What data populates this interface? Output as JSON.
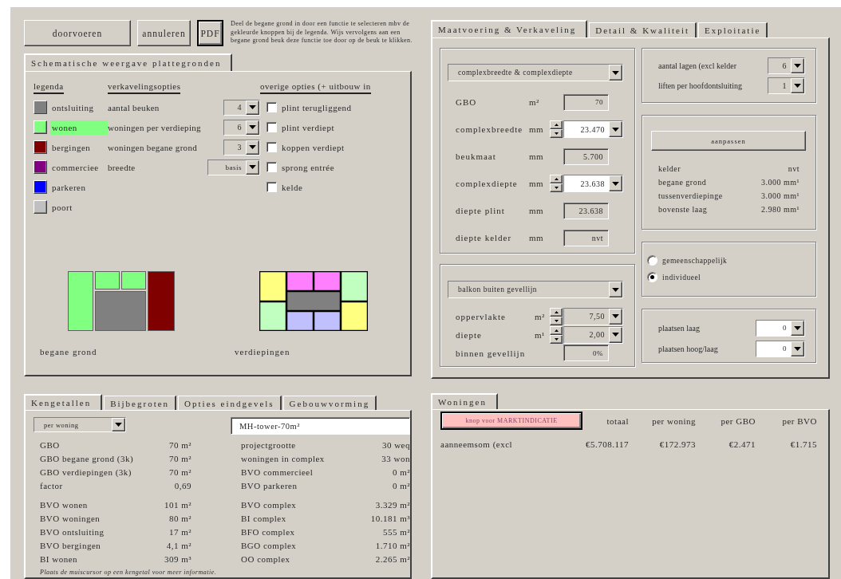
{
  "actions": {
    "buttons": [
      {
        "label": "doorvoeren",
        "focused": false
      },
      {
        "label": "annuleren",
        "focused": false
      },
      {
        "label": "PDF",
        "focused": true
      }
    ],
    "help": "Deel de begane grond in door een functie te selecteren mbv de gekleurde knoppen bij de legenda. Wijs vervolgens aan een begane grond beuk deze functie toe door op de beuk te klikken."
  },
  "schematic": {
    "tabs": [
      {
        "label": "Schematische weergave plattegronden",
        "selected": true
      }
    ],
    "legend_heading": "legenda",
    "legend": [
      {
        "label": "ontsluiting",
        "color": "#808080",
        "selected": false
      },
      {
        "label": "wonen",
        "color": "#80ff80",
        "selected": true
      },
      {
        "label": "bergingen",
        "color": "#800000",
        "selected": false
      },
      {
        "label": "commerciee",
        "color": "#800080",
        "selected": false
      },
      {
        "label": "parkeren",
        "color": "#0000ff",
        "selected": false
      },
      {
        "label": "poort",
        "color": "#c0c0c0",
        "selected": false
      }
    ],
    "lot_heading": "verkavelingsopties",
    "lot_options": [
      {
        "label": "aantal beuken",
        "value": "4"
      },
      {
        "label": "woningen per verdieping",
        "value": "6"
      },
      {
        "label": "woningen begane grond",
        "value": "3"
      },
      {
        "label": "breedte",
        "value": "basis"
      }
    ],
    "other_heading": "overige opties (+ uitbouw in",
    "other_options": [
      {
        "label": "plint terugliggend",
        "checked": false
      },
      {
        "label": "plint verdiept",
        "checked": false
      },
      {
        "label": "koppen verdiept",
        "checked": false
      },
      {
        "label": "sprong entrée",
        "checked": false
      },
      {
        "label": "kelde",
        "checked": false
      }
    ],
    "plans": [
      {
        "label": "begane grond",
        "kind": "ground",
        "cells": [
          {
            "color": "#80ff80"
          },
          {
            "color": "#80ff80"
          },
          {
            "color": "#80ff80"
          },
          {
            "color": "#808080"
          },
          {
            "color": "#800000"
          }
        ]
      },
      {
        "label": "verdiepingen",
        "kind": "floor",
        "cells": [
          {
            "color": "#ffff80"
          },
          {
            "color": "#c0ffc0"
          },
          {
            "color": "#ff80ff"
          },
          {
            "color": "#ff80ff"
          },
          {
            "color": "#808080"
          },
          {
            "color": "#c0c0ff"
          },
          {
            "color": "#c0c0ff"
          },
          {
            "color": "#c0ffc0"
          },
          {
            "color": "#ffff80"
          }
        ]
      }
    ]
  },
  "layout": {
    "tabs": [
      {
        "label": "Maatvoering & Verkaveling",
        "selected": true
      },
      {
        "label": "Detail & Kwaliteit",
        "selected": false
      },
      {
        "label": "Exploitatie",
        "selected": false
      }
    ],
    "dimensions": {
      "mode": "complexbreedte & complexdiepte",
      "rows": [
        {
          "label": "GBO",
          "unit": "m²",
          "value": "70",
          "kind": "readonly",
          "disabled": true
        },
        {
          "label": "complexbreedte",
          "unit": "mm",
          "value": "23.470",
          "kind": "spinner",
          "disabled": false
        },
        {
          "label": "beukmaat",
          "unit": "mm",
          "value": "5.700",
          "kind": "readonly",
          "disabled": true
        },
        {
          "label": "complexdiepte",
          "unit": "mm",
          "value": "23.638",
          "kind": "spinner",
          "disabled": false
        },
        {
          "label": "diepte plint",
          "unit": "mm",
          "value": "23.638",
          "kind": "readonly",
          "disabled": true
        },
        {
          "label": "diepte kelder",
          "unit": "mm",
          "value": "nvt",
          "kind": "readonly",
          "disabled": true
        }
      ]
    },
    "balcony": {
      "mode": "balkon buiten gevellijn",
      "rows": [
        {
          "label": "oppervlakte",
          "unit": "m²",
          "value": "7,50",
          "kind": "spinner",
          "disabled": true
        },
        {
          "label": "diepte",
          "unit": "m¹",
          "value": "2,00",
          "kind": "spinner",
          "disabled": true
        },
        {
          "label": "binnen gevellijn",
          "value": "0%",
          "kind": "readonly",
          "disabled": true
        }
      ]
    },
    "levels": {
      "rows": [
        {
          "label": "aantal lagen (excl kelder",
          "value": "6",
          "disabled": true
        },
        {
          "label": "liften per hoofdontsluiting",
          "value": "1",
          "disabled": true
        }
      ]
    },
    "heights": {
      "button": "aanpassen",
      "rows": [
        {
          "label": "kelder",
          "value": "nvt"
        },
        {
          "label": "begane grond",
          "value": "3.000 mm¹"
        },
        {
          "label": "tussenverdiepinge",
          "value": "3.000 mm¹"
        },
        {
          "label": "bovenste laag",
          "value": "2.980 mm¹"
        }
      ]
    },
    "storage": {
      "options": [
        {
          "label": "gemeenschappelijk",
          "selected": false
        },
        {
          "label": "individueel",
          "selected": true
        }
      ]
    },
    "parking": {
      "rows": [
        {
          "label": "plaatsen laag",
          "value": "0",
          "disabled": false
        },
        {
          "label": "plaatsen hoog/laag",
          "value": "0",
          "disabled": false
        }
      ]
    }
  },
  "kpi": {
    "tabs": [
      {
        "label": "Kengetallen",
        "selected": true
      },
      {
        "label": "Bijbegroten",
        "selected": false
      },
      {
        "label": "Opties eindgevels",
        "selected": false
      },
      {
        "label": "Gebouwvorming",
        "selected": false
      }
    ],
    "basis": "per woning",
    "project_name": "MH-tower-70m²",
    "left_groups": [
      {
        "rows": [
          {
            "label": "GBO",
            "value": "70 m²"
          },
          {
            "label": "GBO begane grond (3k)",
            "value": "70 m²"
          },
          {
            "label": "GBO verdiepingen (3k)",
            "value": "70 m²"
          },
          {
            "label": "factor",
            "value": "0,69"
          }
        ]
      },
      {
        "rows": [
          {
            "label": "BVO wonen",
            "value": "101 m²"
          },
          {
            "label": "BVO woningen",
            "value": "80 m²"
          },
          {
            "label": "BVO ontsluiting",
            "value": "17 m²"
          },
          {
            "label": "BVO bergingen",
            "value": "4,1 m²"
          },
          {
            "label": "BI wonen",
            "value": "309 m³"
          }
        ]
      }
    ],
    "right_groups": [
      {
        "rows": [
          {
            "label": "projectgrootte",
            "value": "30 weq"
          },
          {
            "label": "woningen in complex",
            "value": "33 won"
          },
          {
            "label": "BVO commercieel",
            "value": "0 m²"
          },
          {
            "label": "BVO parkeren",
            "value": "0 m²"
          }
        ]
      },
      {
        "rows": [
          {
            "label": "BVO complex",
            "value": "3.329 m²"
          },
          {
            "label": "BI complex",
            "value": "10.181 m³"
          },
          {
            "label": "BFO complex",
            "value": "555 m²"
          },
          {
            "label": "BGO complex",
            "value": "1.710 m²"
          },
          {
            "label": "OO complex",
            "value": "2.265 m²"
          }
        ]
      }
    ],
    "hint": "Plaats de muiscursor op een kengetal voor meer informatie."
  },
  "costs": {
    "tabs": [
      {
        "label": "Woningen",
        "selected": true
      }
    ],
    "button": {
      "label": "knop voor MARKTINDICATIE",
      "focused": true
    },
    "columns": [
      "totaal",
      "per woning",
      "per GBO",
      "per BVO"
    ],
    "rows": [
      {
        "label": "aanneemsom (excl",
        "values": [
          "€5.708.117",
          "€172.973",
          "€2.471",
          "€1.715"
        ]
      }
    ]
  }
}
